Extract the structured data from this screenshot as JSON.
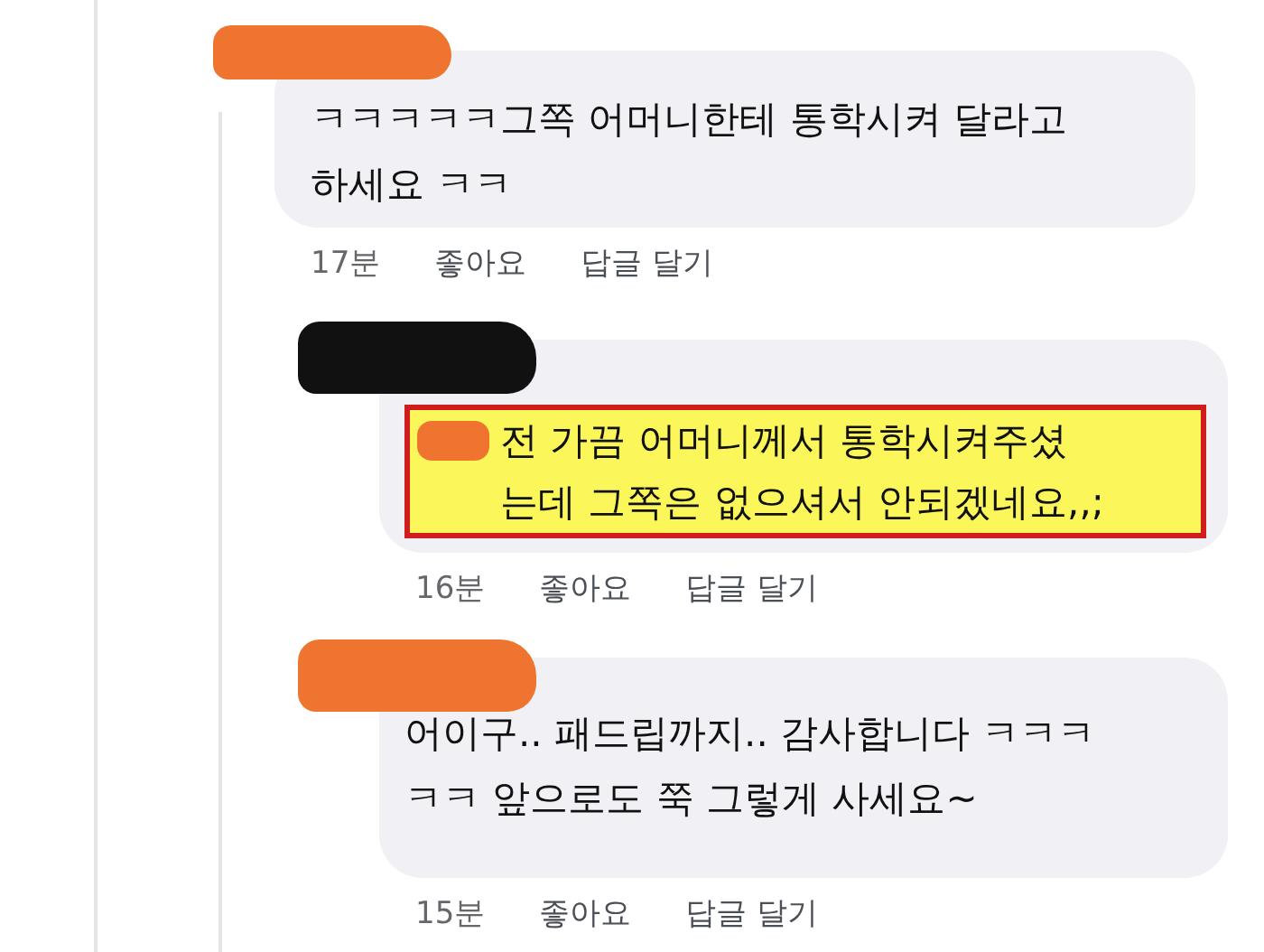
{
  "comments": [
    {
      "redaction": {
        "color": "#ee7430"
      },
      "lines": [
        "ㅋㅋㅋㅋㅋ그쪽 어머니한테 통학시켜 달라고",
        "하세요 ㅋㅋ"
      ],
      "highlighted": false,
      "reply": false,
      "time": "17분",
      "like": "좋아요",
      "reply_action": "답글 달기"
    },
    {
      "redaction": {
        "color": "#111111"
      },
      "lines": [
        "전 가끔 어머니께서 통학시켜주셨",
        "는데 그쪽은 없으셔서 안되겠네요,,;"
      ],
      "highlighted": true,
      "reply": true,
      "time": "16분",
      "like": "좋아요",
      "reply_action": "답글 달기"
    },
    {
      "redaction": {
        "color": "#ee7430"
      },
      "lines": [
        "어이구.. 패드립까지.. 감사합니다 ㅋㅋㅋ",
        "ㅋㅋ 앞으로도 쭉 그렇게 사세요~"
      ],
      "highlighted": false,
      "reply": true,
      "time": "15분",
      "like": "좋아요",
      "reply_action": "답글 달기"
    }
  ]
}
